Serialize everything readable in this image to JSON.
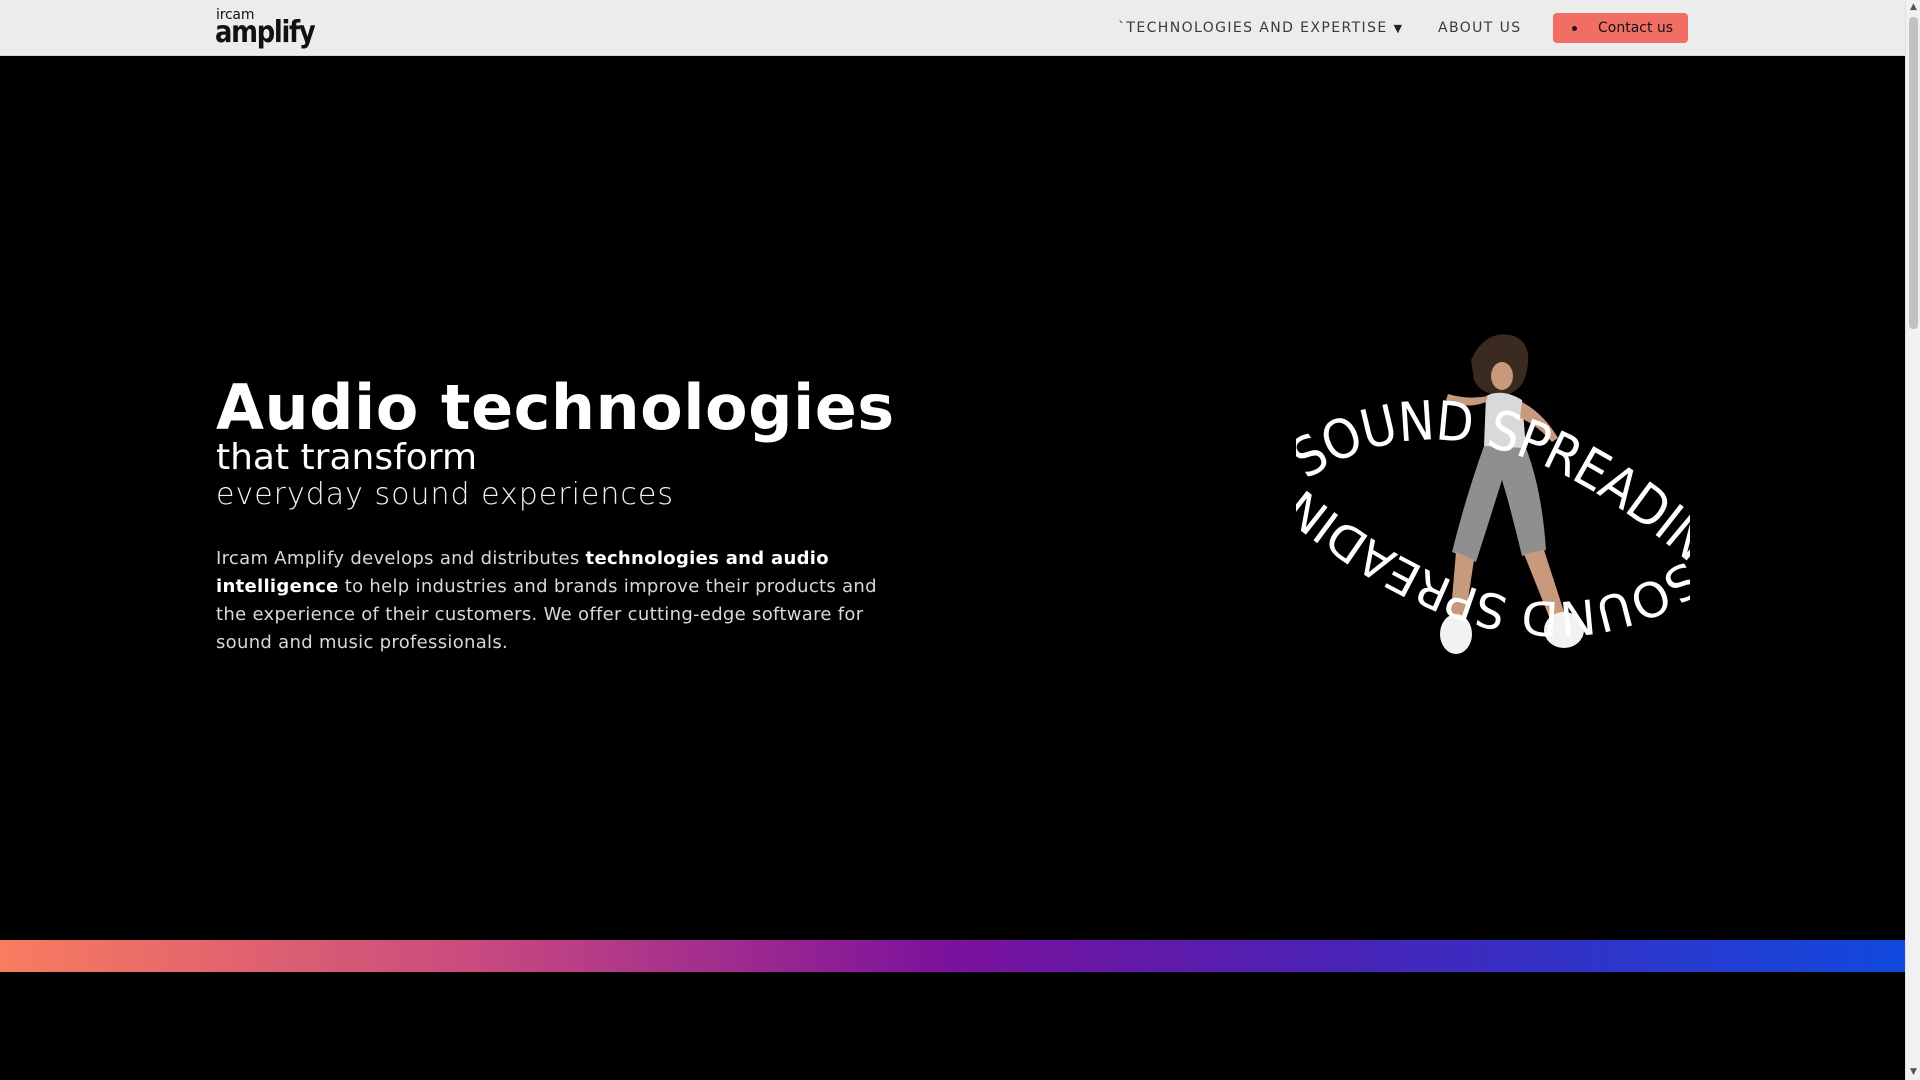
{
  "header": {
    "logo": {
      "small": "ircam",
      "big": "amplify"
    },
    "nav": {
      "technologies": "`TECHNOLOGIES AND EXPERTISE",
      "about": "ABOUT US"
    },
    "contact_label": "Contact us"
  },
  "hero": {
    "title": "Audio technologies",
    "subtitle1": "that transform",
    "subtitle2": "everyday sound experiences",
    "desc_part1": "Ircam Amplify develops and distributes ",
    "desc_bold": "technologies and audio intelligence",
    "desc_part2": " to help industries and brands improve their products and the experience of their customers. We offer cutting-edge software for sound and music professionals.",
    "illustration": {
      "text_top": "SOUND SPREADING",
      "text_bottom": "SOUND SPREADING"
    }
  },
  "colors": {
    "header_bg": "#ececec",
    "accent": "#f26d63",
    "gradient": [
      "#f87c5e",
      "#c94a7f",
      "#7a119c",
      "#4a22b6",
      "#1149de"
    ]
  },
  "icons": {
    "caret": "caret-down-icon",
    "contact_dot": "dot-icon"
  }
}
